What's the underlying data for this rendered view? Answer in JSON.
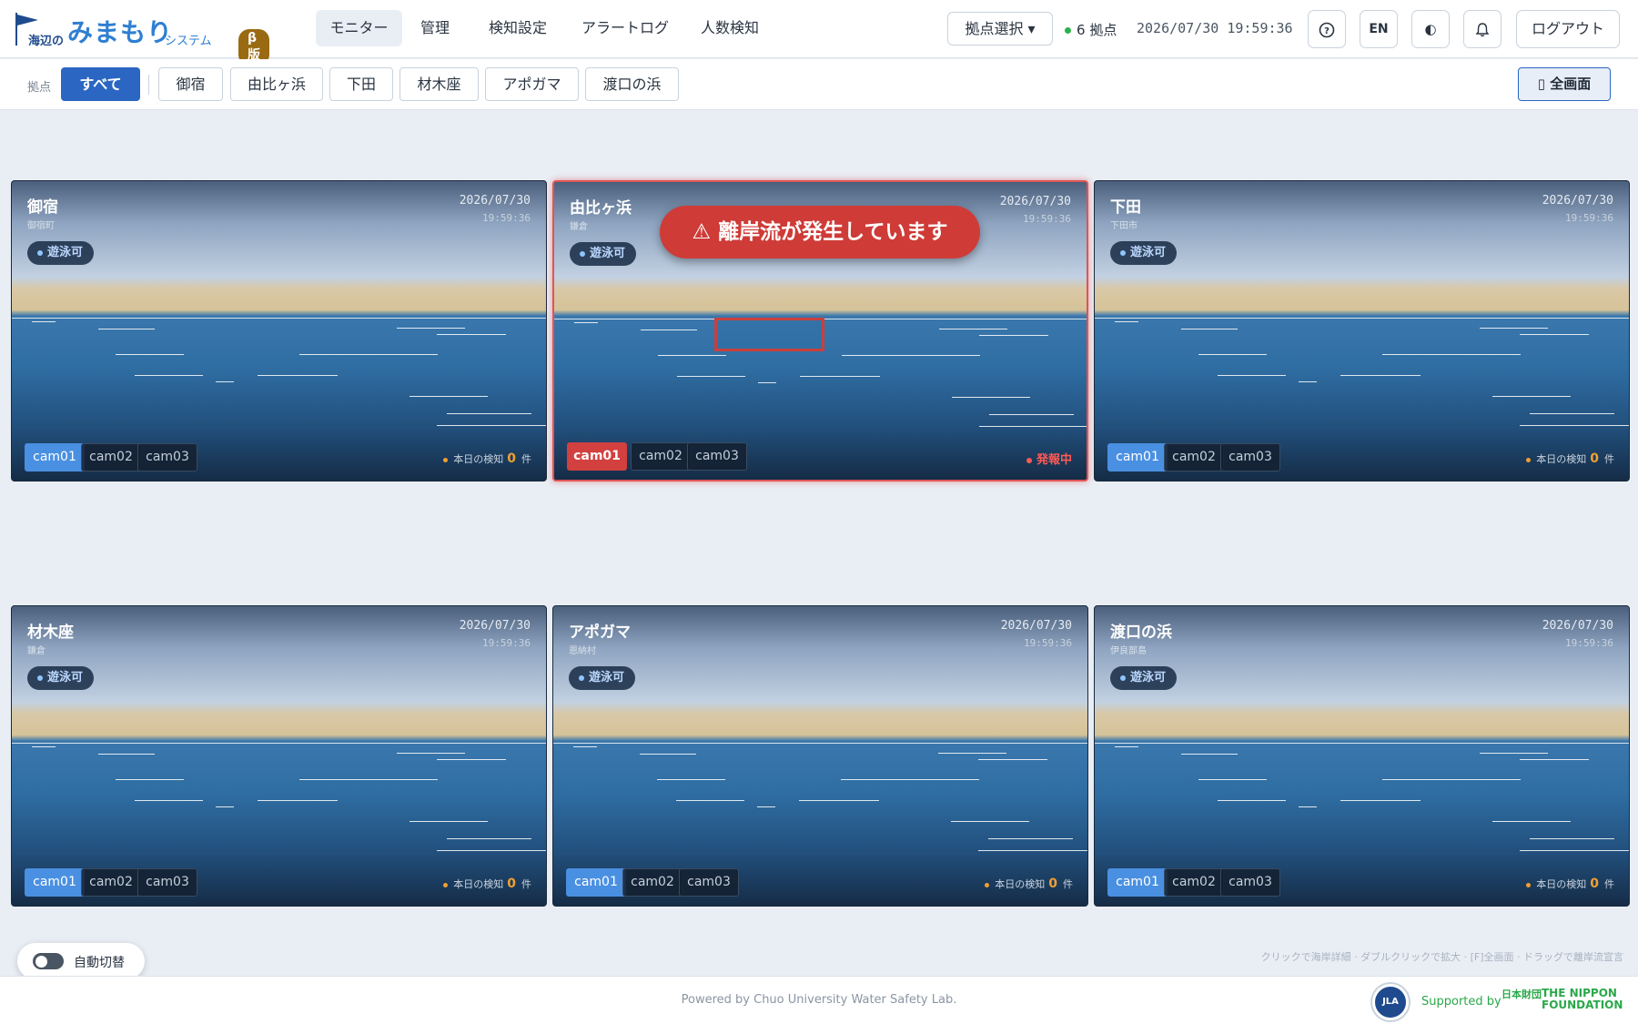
{
  "app": {
    "logo_prefix": "海辺の",
    "logo_main": "みまもり",
    "logo_suffix": "システム",
    "beta": "β版"
  },
  "nav": [
    {
      "label": "モニター",
      "active": true
    },
    {
      "label": "管理"
    },
    {
      "label": "検知設定"
    },
    {
      "label": "アラートログ"
    },
    {
      "label": "人数検知"
    }
  ],
  "header": {
    "site_select": "拠点選択 ▾",
    "site_count": "6",
    "site_count_unit": "拠点",
    "datetime": "2026/07/30 19:59:36",
    "help_icon": "?",
    "lang": "EN",
    "theme_icon": "◐",
    "bell_icon": "bell-icon",
    "logout": "ログアウト"
  },
  "filter": {
    "label": "拠点",
    "chips": [
      "すべて",
      "御宿",
      "由比ヶ浜",
      "下田",
      "材木座",
      "アポガマ",
      "渡口の浜"
    ],
    "active_index": 0,
    "fullscreen": "▯ 全画面"
  },
  "cameras": [
    {
      "name": "御宿",
      "sub": "御宿町",
      "date": "2026/07/30",
      "time": "19:59:36",
      "status": "遊泳可",
      "cams": [
        "cam01",
        "cam02",
        "cam03"
      ],
      "detect_label": "本日の検知",
      "detect_count": "0",
      "detect_unit": "件",
      "alert": false
    },
    {
      "name": "由比ヶ浜",
      "sub": "鎌倉",
      "date": "2026/07/30",
      "time": "19:59:36",
      "status": "遊泳可",
      "cams": [
        "cam01",
        "cam02",
        "cam03"
      ],
      "alert": true,
      "alert_text": "⚠ 離岸流が発生しています",
      "alarm_label": "発報中"
    },
    {
      "name": "下田",
      "sub": "下田市",
      "date": "2026/07/30",
      "time": "19:59:36",
      "status": "遊泳可",
      "cams": [
        "cam01",
        "cam02",
        "cam03"
      ],
      "detect_label": "本日の検知",
      "detect_count": "0",
      "detect_unit": "件",
      "alert": false
    },
    {
      "name": "材木座",
      "sub": "鎌倉",
      "date": "2026/07/30",
      "time": "19:59:36",
      "status": "遊泳可",
      "cams": [
        "cam01",
        "cam02",
        "cam03"
      ],
      "detect_label": "本日の検知",
      "detect_count": "0",
      "detect_unit": "件",
      "alert": false
    },
    {
      "name": "アポガマ",
      "sub": "恩納村",
      "date": "2026/07/30",
      "time": "19:59:36",
      "status": "遊泳可",
      "cams": [
        "cam01",
        "cam02",
        "cam03"
      ],
      "detect_label": "本日の検知",
      "detect_count": "0",
      "detect_unit": "件",
      "alert": false
    },
    {
      "name": "渡口の浜",
      "sub": "伊良部島",
      "date": "2026/07/30",
      "time": "19:59:36",
      "status": "遊泳可",
      "cams": [
        "cam01",
        "cam02",
        "cam03"
      ],
      "detect_label": "本日の検知",
      "detect_count": "0",
      "detect_unit": "件",
      "alert": false
    }
  ],
  "footer": {
    "hint": "クリックで海岸詳細 · ダブルクリックで拡大 · [F]全画面 · ドラッグで離岸流宣言",
    "auto_switch": "自動切替",
    "powered": "Powered by Chuo University Water Safety Lab.",
    "badge": "JLA",
    "supported": "Supported by",
    "nippon_jp": "日本財団",
    "nippon_en_1": "THE NIPPON",
    "nippon_en_2": "FOUNDATION"
  },
  "colors": {
    "accent": "#2b66c3",
    "alert": "#cf3b37",
    "status_ok": "#2bb24c",
    "beta": "#9a6a12"
  }
}
